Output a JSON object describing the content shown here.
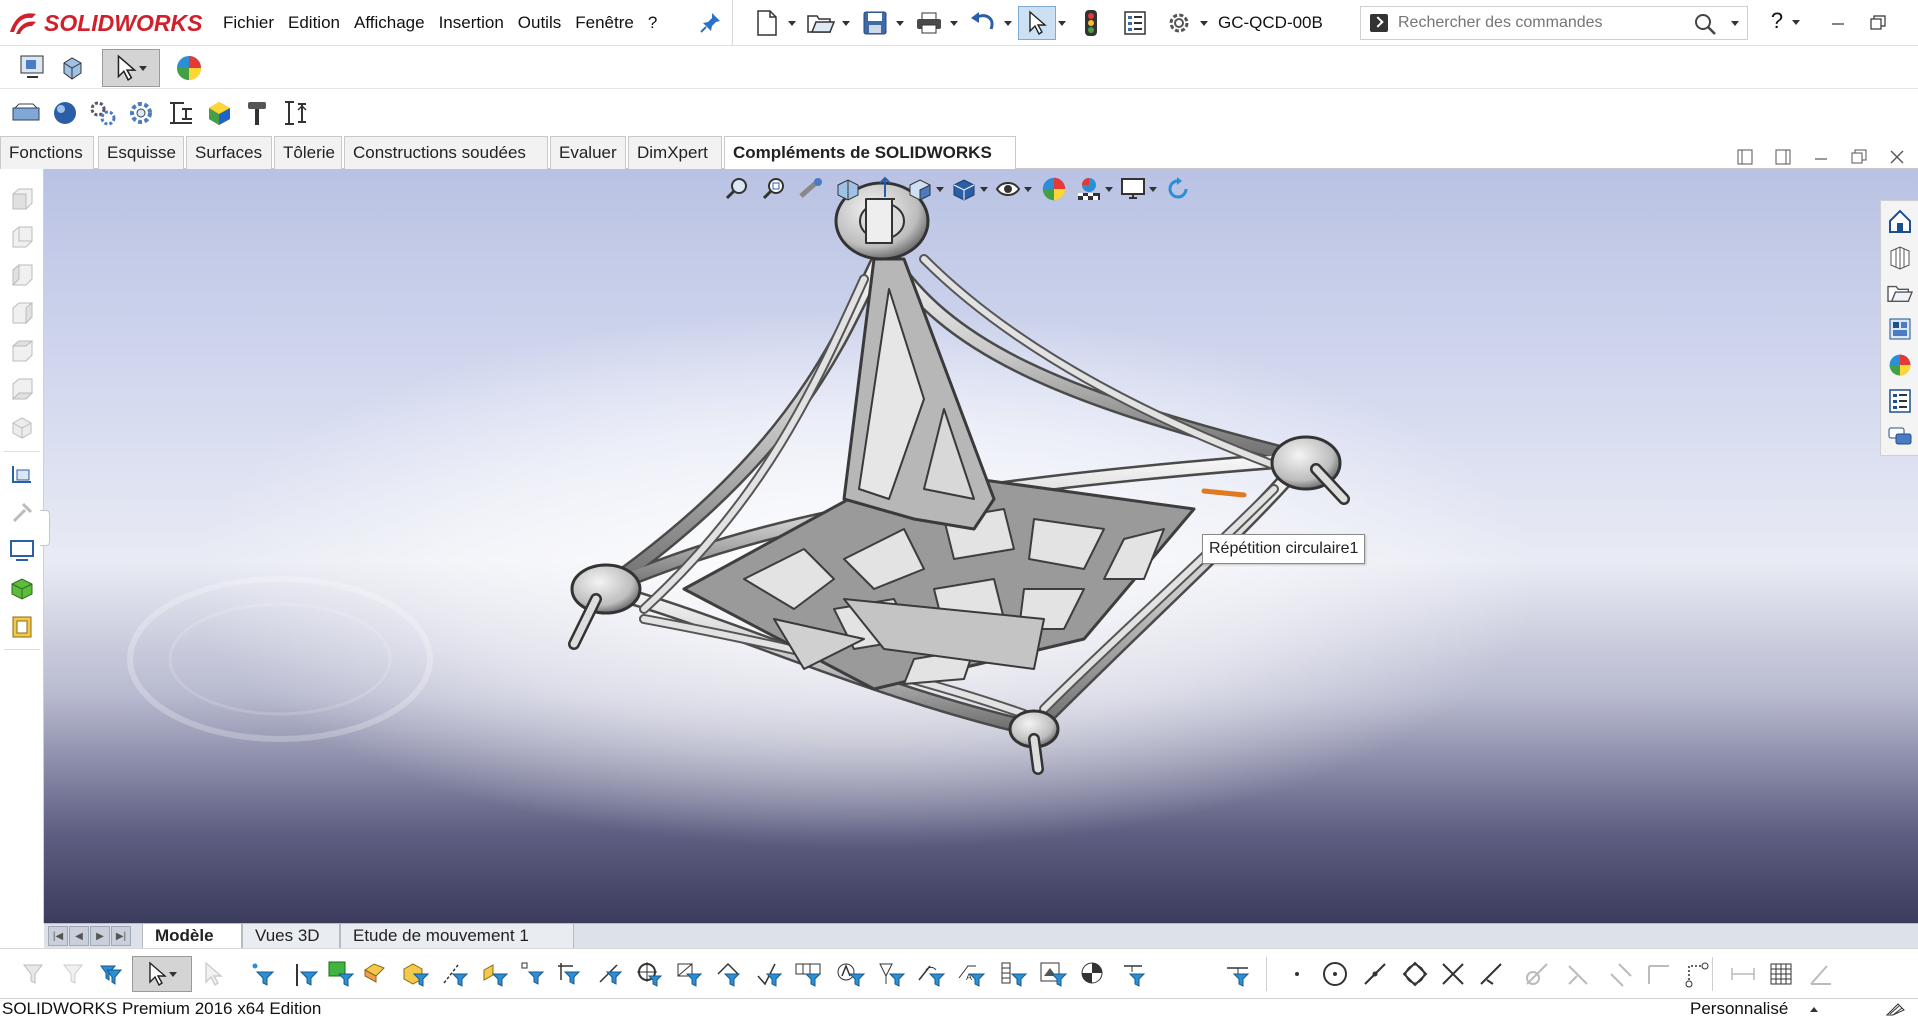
{
  "app": {
    "logo_text": "SOLIDWORKS",
    "document_title": "GC-QCD-00B"
  },
  "menu": [
    "Fichier",
    "Edition",
    "Affichage",
    "Insertion",
    "Outils",
    "Fenêtre",
    "?"
  ],
  "search": {
    "placeholder": "Rechercher des commandes"
  },
  "help_label": "?",
  "commandmanager_tabs": [
    {
      "label": "Fonctions",
      "active": false
    },
    {
      "label": "Esquisse",
      "active": false
    },
    {
      "label": "Surfaces",
      "active": false
    },
    {
      "label": "Tôlerie",
      "active": false
    },
    {
      "label": "Constructions soudées",
      "active": false
    },
    {
      "label": "Evaluer",
      "active": false
    },
    {
      "label": "DimXpert",
      "active": false
    },
    {
      "label": "Compléments de SOLIDWORKS",
      "active": true
    }
  ],
  "tooltip": "Répétition circulaire1",
  "bottom_tabs": [
    {
      "label": "Modèle",
      "active": true
    },
    {
      "label": "Vues 3D",
      "active": false
    },
    {
      "label": "Etude de mouvement 1",
      "active": false
    }
  ],
  "status": {
    "edition": "SOLIDWORKS Premium 2016 x64 Edition",
    "units": "Personnalisé"
  },
  "colors": {
    "brand_red": "#d0202b",
    "viewport_top": "#b9c2e3",
    "viewport_bottom": "#3b3c5c",
    "highlight_orange": "#e07a1f"
  }
}
